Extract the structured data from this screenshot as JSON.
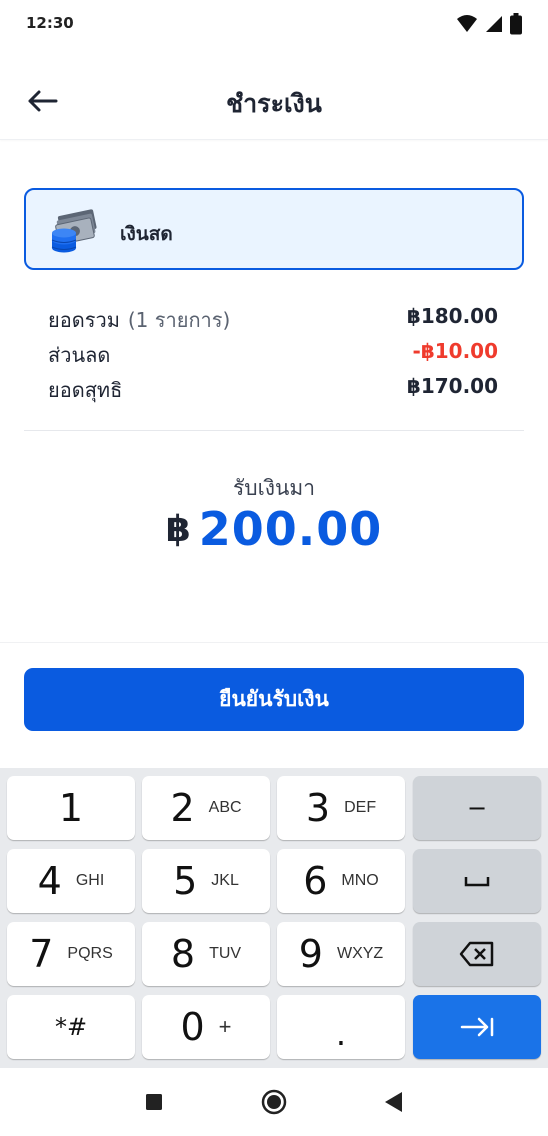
{
  "status_bar": {
    "time": "12:30",
    "icons": [
      "wifi-icon",
      "signal-icon",
      "battery-icon"
    ]
  },
  "header": {
    "title": "ชำระเงิน",
    "back_icon": "arrow-left-icon"
  },
  "payment_method": {
    "label": "เงินสด",
    "icon": "cash-coins-icon"
  },
  "summary": {
    "subtotal_label": "ยอดรวม",
    "subtotal_items": "(1 รายการ)",
    "subtotal_value": "฿180.00",
    "discount_label": "ส่วนลด",
    "discount_value": "-฿10.00",
    "net_label": "ยอดสุทธิ",
    "net_value": "฿170.00"
  },
  "received": {
    "label": "รับเงินมา",
    "currency": "฿",
    "amount": "200.00"
  },
  "confirm_button": {
    "label": "ยืนยันรับเงิน"
  },
  "keypad": {
    "keys": [
      {
        "num": "1",
        "letters": ""
      },
      {
        "num": "2",
        "letters": "ABC"
      },
      {
        "num": "3",
        "letters": "DEF"
      },
      {
        "num": "4",
        "letters": "GHI"
      },
      {
        "num": "5",
        "letters": "JKL"
      },
      {
        "num": "6",
        "letters": "MNO"
      },
      {
        "num": "7",
        "letters": "PQRS"
      },
      {
        "num": "8",
        "letters": "TUV"
      },
      {
        "num": "9",
        "letters": "WXYZ"
      },
      {
        "num": "*#",
        "letters": ""
      },
      {
        "num": "0",
        "letters": "+"
      },
      {
        "num": ".",
        "letters": ""
      }
    ],
    "minus": "−",
    "space_icon": "space-bar-icon",
    "backspace_icon": "backspace-icon",
    "next_icon": "tab-next-icon"
  },
  "nav_bar": {
    "icons": [
      "recents-square-icon",
      "home-circle-icon",
      "back-triangle-icon"
    ]
  },
  "colors": {
    "accent": "#0a5be0",
    "accent_light": "#eaf4ff",
    "discount_red": "#ef3b2d",
    "keypad_bg": "#e8eaed",
    "key_blue": "#1a73e8"
  }
}
